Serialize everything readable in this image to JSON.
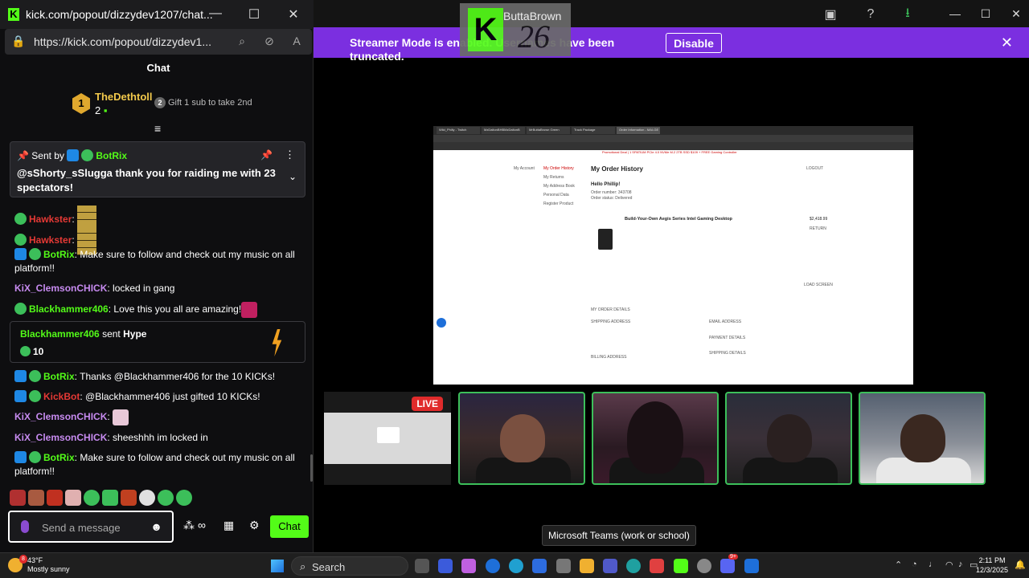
{
  "popout": {
    "window_title": "kick.com/popout/dizzydev1207/chat...",
    "url": "https://kick.com/popout/dizzydev1...",
    "chat_header": "Chat",
    "leaderboard": {
      "rank": "1",
      "name": "TheDethtoll",
      "count": "2",
      "gift_rank": "2",
      "gift_text": "Gift 1 sub to take 2nd"
    },
    "pinned": {
      "sent_by_label": "Sent by",
      "sender": "BotRix",
      "text": "@sShorty_sSlugga thank you for raiding me with 23 spectators!"
    },
    "messages": [
      {
        "user": "Hawkster",
        "user_color": "#e53935",
        "text": ""
      },
      {
        "user": "Hawkster",
        "user_color": "#e53935",
        "text": ""
      },
      {
        "user": "BotRix",
        "user_color": "#53fc18",
        "text": "Make sure to follow and check out my music on all platform!!"
      },
      {
        "user": "KiX_ClemsonCHICK",
        "user_color": "#c78bf0",
        "text": "locked in gang"
      },
      {
        "user": "Blackhammer406",
        "user_color": "#53fc18",
        "text": "Love this you all are amazing!"
      },
      {
        "user": "BotRix",
        "user_color": "#53fc18",
        "text": "Thanks @Blackhammer406 for the 10 KICKs!"
      },
      {
        "user": "KickBot",
        "user_color": "#e53935",
        "text": "@Blackhammer406 just gifted 10 KICKs!"
      },
      {
        "user": "KiX_ClemsonCHICK",
        "user_color": "#c78bf0",
        "text": ""
      },
      {
        "user": "KiX_ClemsonCHICK",
        "user_color": "#c78bf0",
        "text": "sheeshhh im locked in"
      },
      {
        "user": "BotRix",
        "user_color": "#53fc18",
        "text": "Make sure to follow and check out my music on all platform!!"
      }
    ],
    "hype": {
      "user": "Blackhammer406",
      "sent_label": "sent",
      "item": "Hype",
      "amount": "10"
    },
    "input": {
      "placeholder": "Send a message",
      "chat_button": "Chat"
    }
  },
  "background": {
    "kick_badge_number": "26",
    "kick_badge_name": "ButtaBrown",
    "streamer_banner": "Streamer Mode is enabled. Usernames have been truncated.",
    "disable_button": "Disable",
    "live_badge": "LIVE",
    "tooltip": "Microsoft Teams (work or school)",
    "shared_screen": {
      "tabs": [
        "Wild_Philly - Twitch",
        "MzDaltonBHBMzDaltonB",
        "MrButtaBrown Green",
        "Track Package",
        "Order Information - MAI-GE"
      ],
      "promo": "Promotional Deal | 1 SPATIUM PCIe 4.0 NVMe M.2 2TB SSD $109 + FREE Gaming Controller",
      "nav": [
        "My Account",
        "My Order History",
        "My Returns",
        "My Address Book",
        "Personal Data",
        "Register Product"
      ],
      "heading": "My Order History",
      "logout": "LOGOUT",
      "hello": "Hello Phillip!",
      "order_number": "Order number: 343708",
      "order_status": "Order status: Delivered",
      "product": "Build-Your-Own Aegis Series Intel Gaming Desktop",
      "price": "$2,418.99",
      "returns": "RETURN",
      "load_screen": "LOAD SCREEN",
      "order_details": "MY ORDER DETAILS",
      "shipping_address": "SHIPPING ADDRESS",
      "billing_address": "BILLING ADDRESS",
      "email_address": "EMAIL ADDRESS",
      "payment_details": "PAYMENT DETAILS",
      "shipping_details": "SHIPPING DETAILS"
    }
  },
  "taskbar": {
    "weather_temp": "43°F",
    "weather_desc": "Mostly sunny",
    "weather_alert": "8",
    "search": "Search",
    "discord_badge": "9+",
    "time": "2:11 PM",
    "date": "12/3/2025"
  }
}
